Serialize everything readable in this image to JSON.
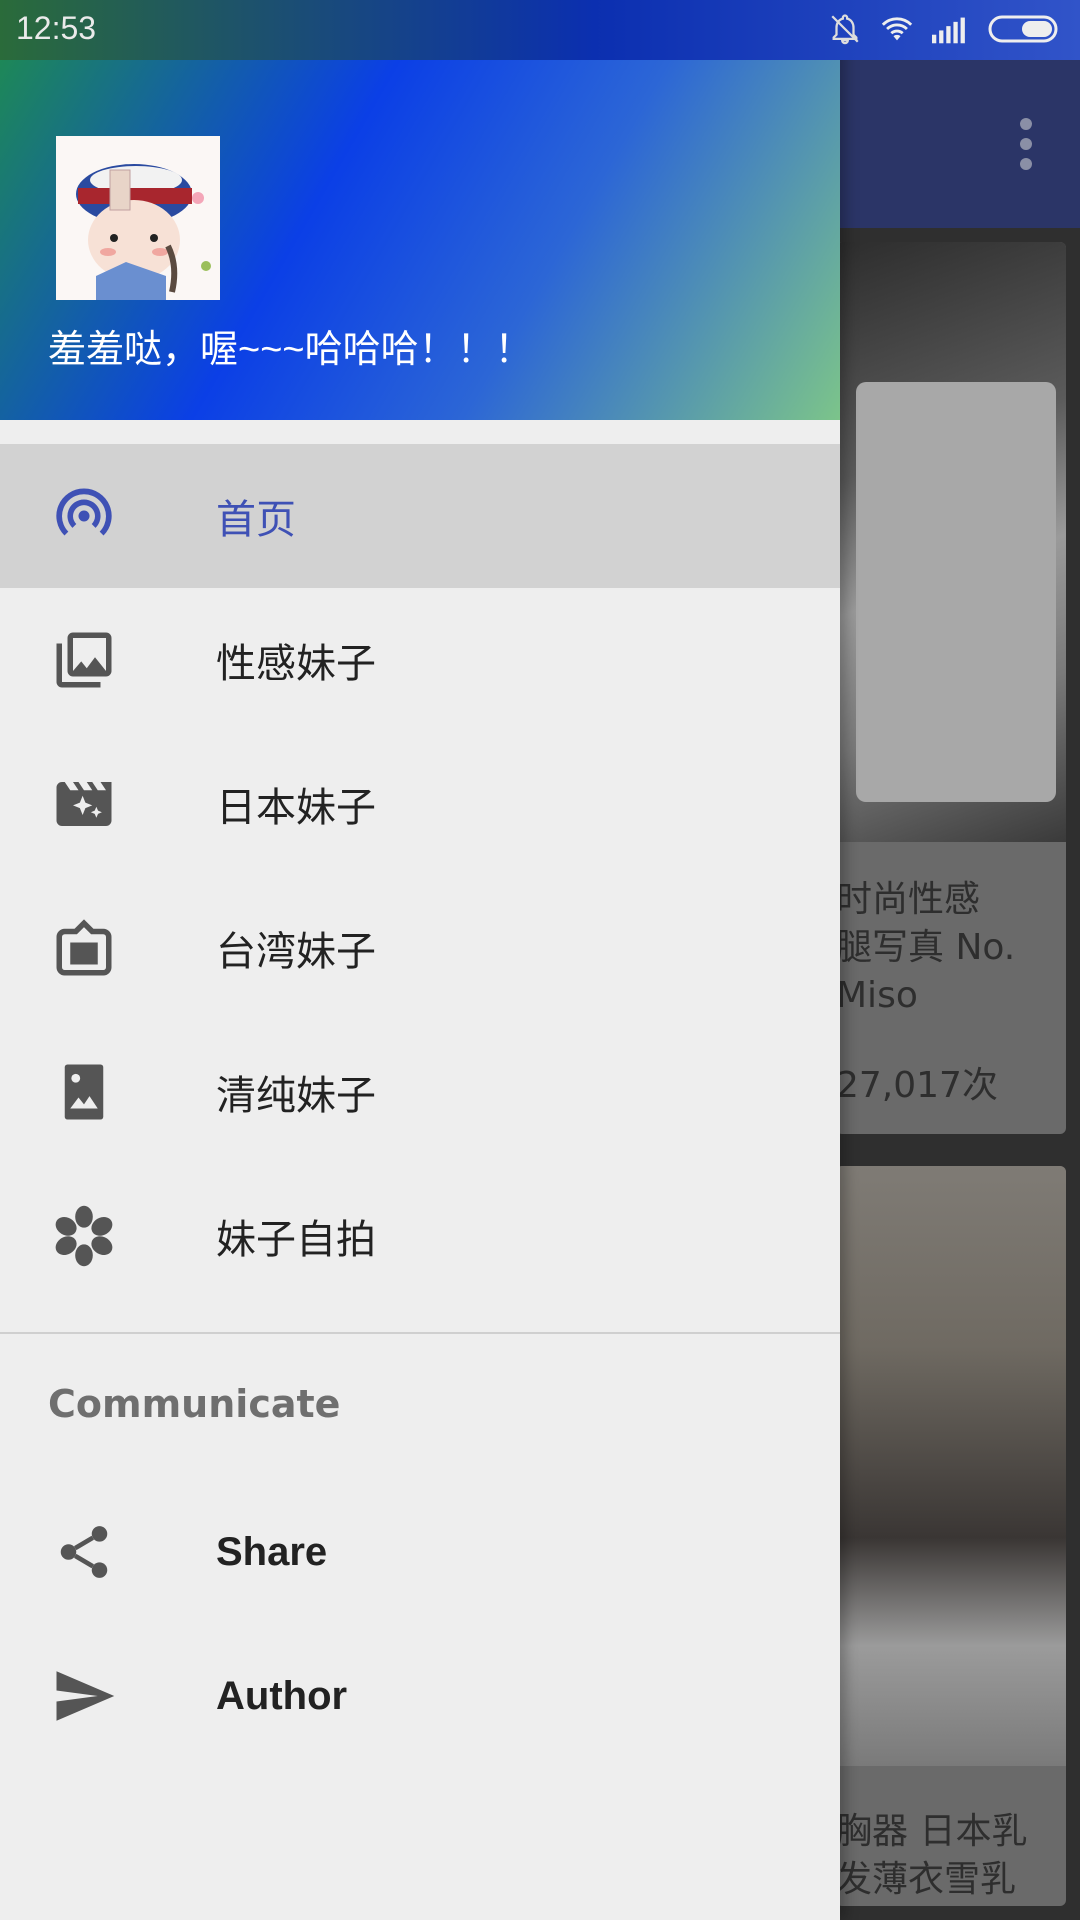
{
  "status_bar": {
    "time": "12:53",
    "icons": [
      "bell-off-icon",
      "wifi-icon",
      "signal-icon",
      "battery-icon"
    ]
  },
  "drawer": {
    "header_title": "羞羞哒，喔~~~哈哈哈！！！",
    "menu_items": [
      {
        "label": "首页",
        "icon": "broadcast-icon",
        "active": true
      },
      {
        "label": "性感妹子",
        "icon": "photo-library-icon",
        "active": false
      },
      {
        "label": "日本妹子",
        "icon": "movie-filter-icon",
        "active": false
      },
      {
        "label": "台湾妹子",
        "icon": "tv-frame-icon",
        "active": false
      },
      {
        "label": "清纯妹子",
        "icon": "portrait-photo-icon",
        "active": false
      },
      {
        "label": "妹子自拍",
        "icon": "flower-icon",
        "active": false
      }
    ],
    "section_title": "Communicate",
    "communicate_items": [
      {
        "label": "Share",
        "icon": "share-icon"
      },
      {
        "label": "Author",
        "icon": "send-icon"
      }
    ]
  },
  "background": {
    "card1_lines": [
      "时尚性感",
      "腿写真 No.",
      "Miso"
    ],
    "card1_count": "27,017次",
    "card2_lines": [
      "胸器 日本乳",
      "发薄衣雪乳"
    ]
  },
  "colors": {
    "accent": "#3f51b5",
    "drawer_bg": "#eeeeee",
    "active_bg": "#d2d2d2"
  }
}
